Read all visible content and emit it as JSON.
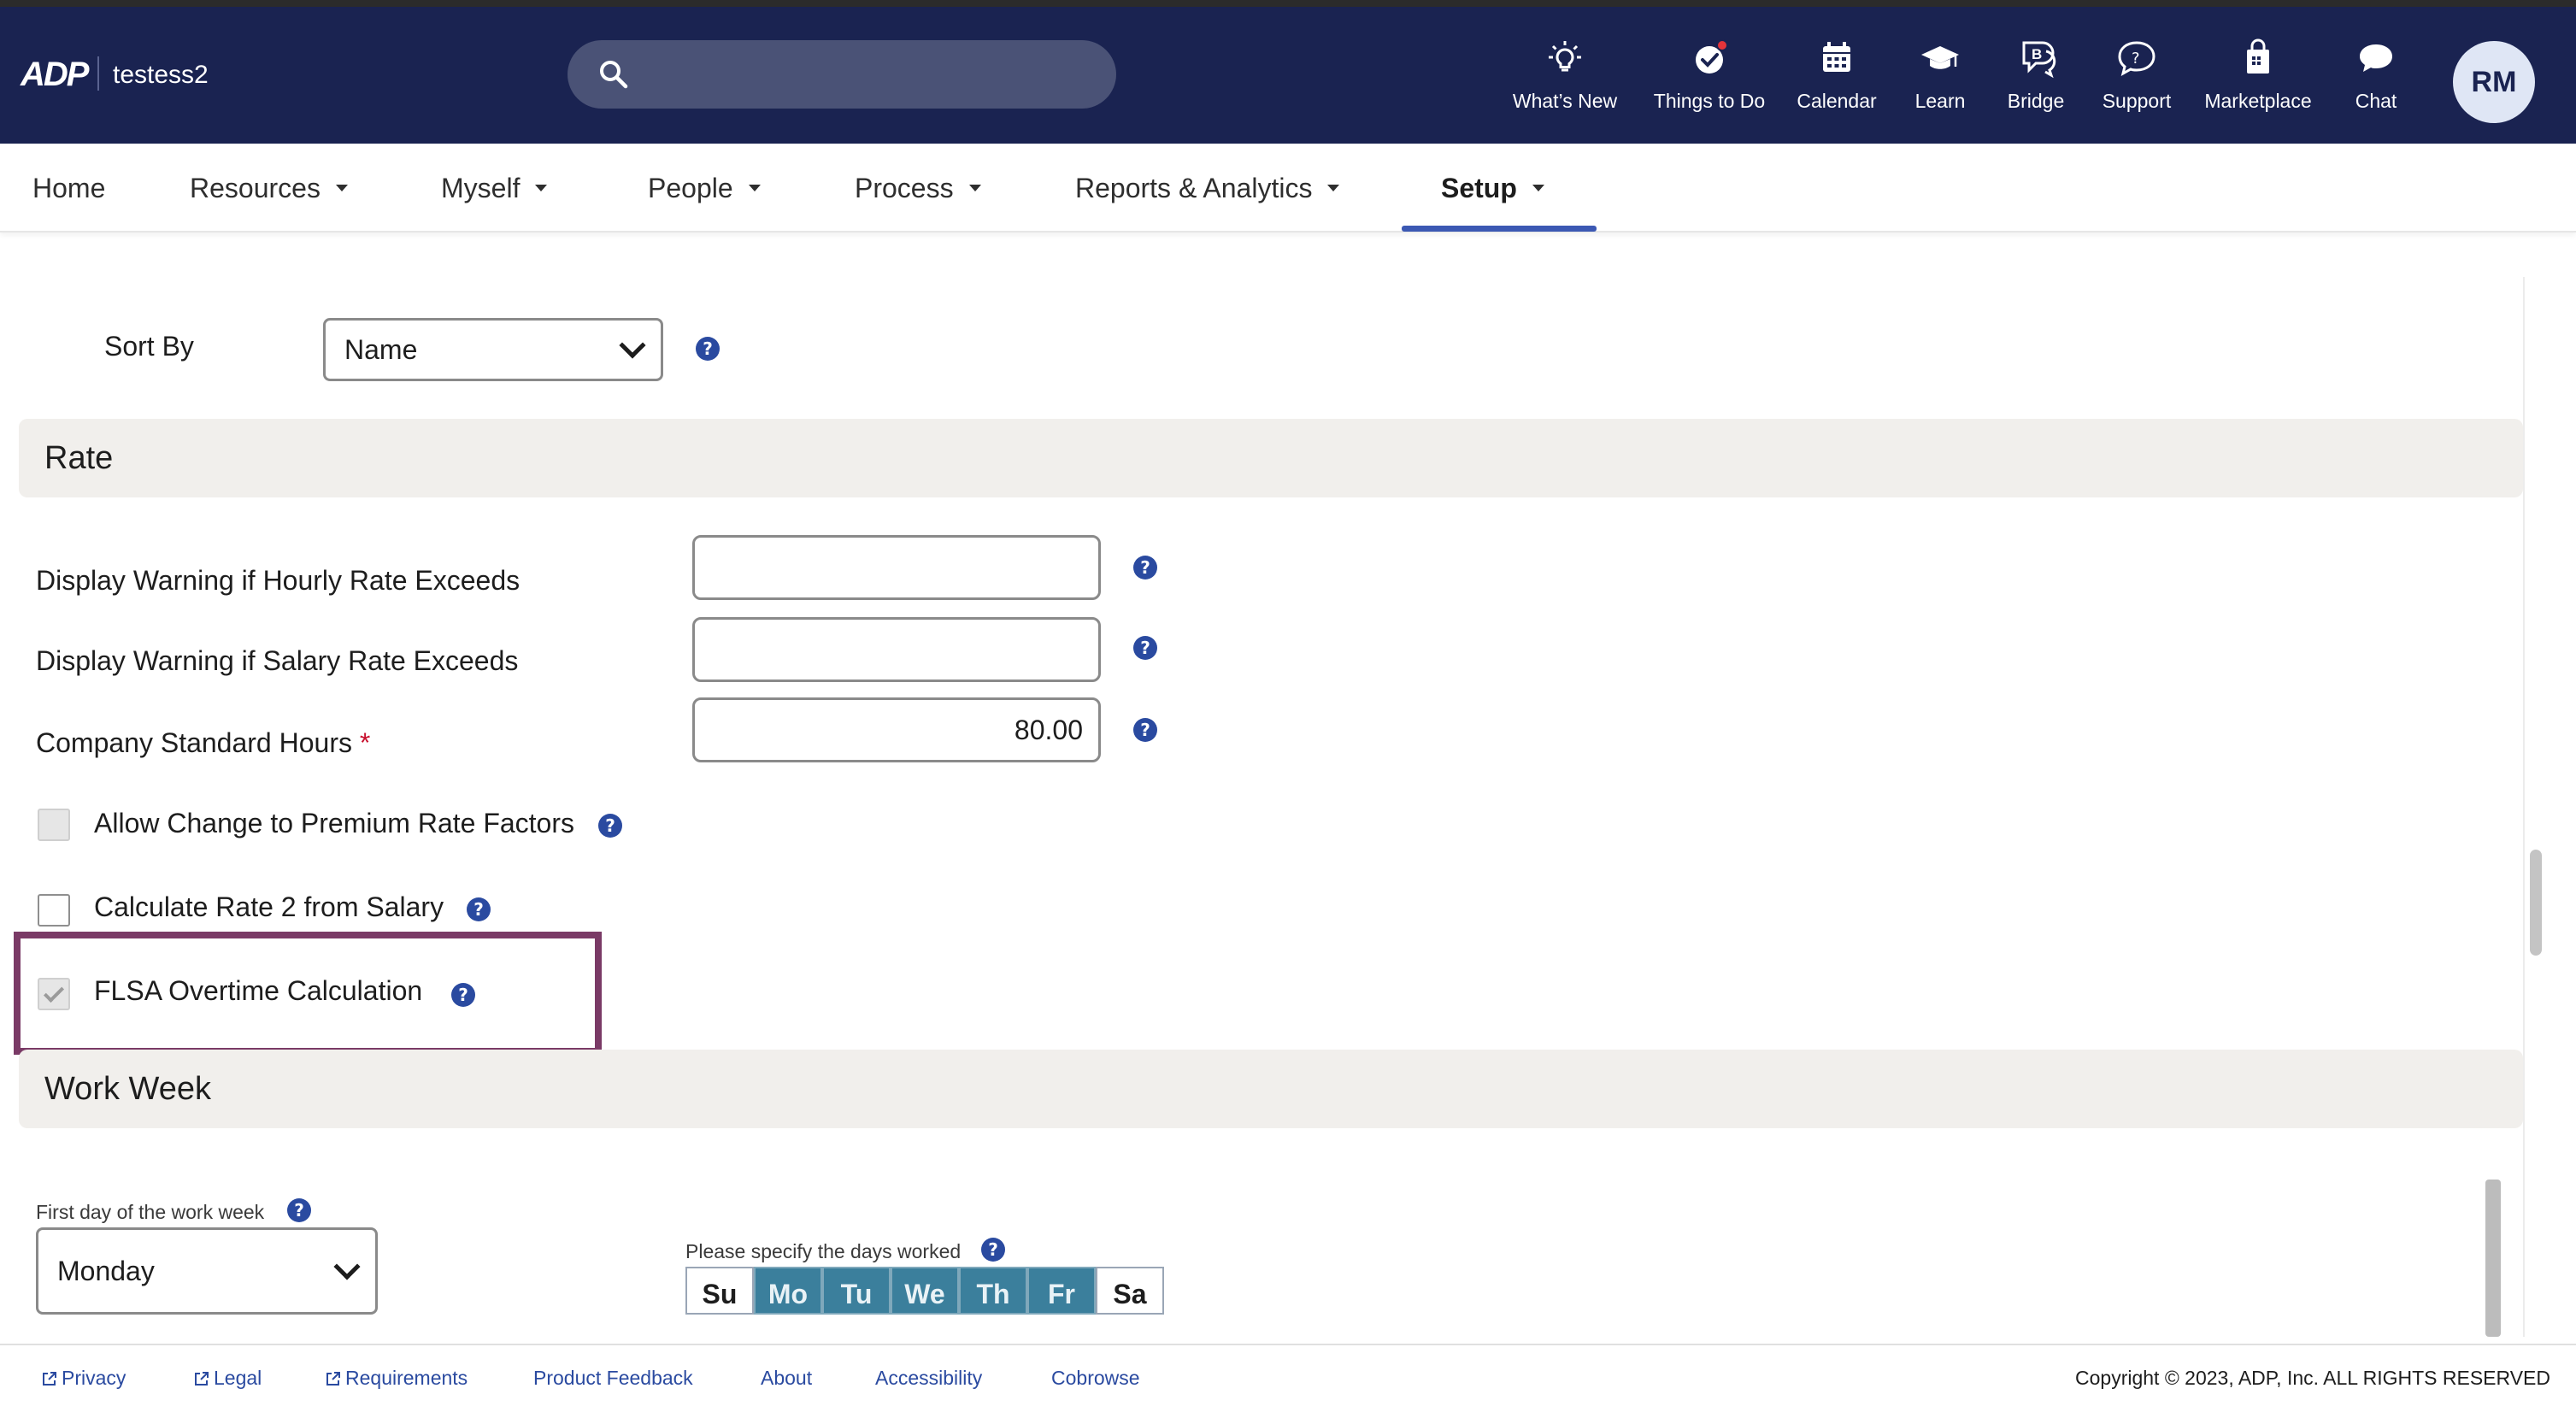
{
  "header": {
    "logo": "ADP",
    "company": "testess2",
    "search": {
      "placeholder": "",
      "value": ""
    },
    "nav": [
      {
        "label": "What’s New",
        "icon": "lightbulb-icon"
      },
      {
        "label": "Things to Do",
        "icon": "check-circle-icon",
        "has_notification": true
      },
      {
        "label": "Calendar",
        "icon": "calendar-icon"
      },
      {
        "label": "Learn",
        "icon": "graduation-cap-icon"
      },
      {
        "label": "Bridge",
        "icon": "bridge-icon"
      },
      {
        "label": "Support",
        "icon": "question-bubble-icon"
      },
      {
        "label": "Marketplace",
        "icon": "shopping-bag-icon"
      },
      {
        "label": "Chat",
        "icon": "chat-bubble-icon"
      }
    ],
    "avatar_initials": "RM"
  },
  "menu": {
    "items": [
      {
        "label": "Home",
        "has_caret": false
      },
      {
        "label": "Resources",
        "has_caret": true
      },
      {
        "label": "Myself",
        "has_caret": true
      },
      {
        "label": "People",
        "has_caret": true
      },
      {
        "label": "Process",
        "has_caret": true
      },
      {
        "label": "Reports & Analytics",
        "has_caret": true
      },
      {
        "label": "Setup",
        "has_caret": true,
        "active": true
      }
    ],
    "accent_color": "#3b58b3"
  },
  "sort": {
    "label": "Sort By",
    "value": "Name"
  },
  "rate": {
    "title": "Rate",
    "hourly_label": "Display Warning if Hourly Rate Exceeds",
    "hourly_value": "",
    "salary_label": "Display Warning if Salary Rate Exceeds",
    "salary_value": "",
    "standard_hours_label": "Company Standard Hours",
    "required_mark": "*",
    "standard_hours_value": "80.00",
    "premium_label": "Allow Change to Premium Rate Factors",
    "premium_checked": false,
    "rate2_label": "Calculate Rate 2 from Salary",
    "rate2_checked": false,
    "flsa_label": "FLSA Overtime Calculation",
    "flsa_checked": true
  },
  "work_week": {
    "title": "Work Week",
    "first_day_label": "First day of the work week",
    "first_day_value": "Monday",
    "days_label": "Please specify the days worked",
    "days": [
      {
        "label": "Su",
        "worked": false
      },
      {
        "label": "Mo",
        "worked": true
      },
      {
        "label": "Tu",
        "worked": true
      },
      {
        "label": "We",
        "worked": true
      },
      {
        "label": "Th",
        "worked": true
      },
      {
        "label": "Fr",
        "worked": true
      },
      {
        "label": "Sa",
        "worked": false
      }
    ],
    "worked_color": "#3b7f9c"
  },
  "footer": {
    "links": [
      "Privacy",
      "Legal",
      "Requirements",
      "Product Feedback",
      "About",
      "Accessibility",
      "Cobrowse"
    ],
    "copyright": "Copyright © 2023, ADP, Inc. ALL RIGHTS RESERVED"
  },
  "colors": {
    "header_bg": "#1a2351",
    "highlight": "#7a3a66",
    "help_icon": "#2a4aa0",
    "section_bg": "#f1efec"
  }
}
